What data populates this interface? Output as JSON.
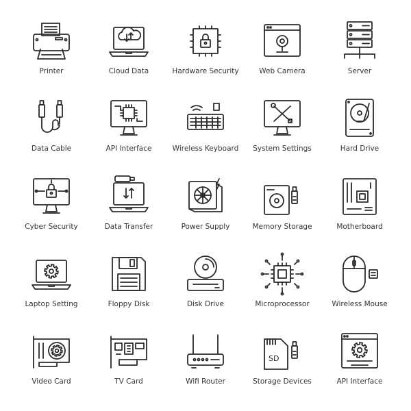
{
  "icon_color": "#2b2b2b",
  "background": "#ffffff",
  "sd_label": "SD",
  "icons": [
    {
      "label": "Printer",
      "icon": "printer-icon"
    },
    {
      "label": "Cloud Data",
      "icon": "cloud-data-icon"
    },
    {
      "label": "Hardware Security",
      "icon": "hardware-security-icon"
    },
    {
      "label": "Web Camera",
      "icon": "web-camera-icon"
    },
    {
      "label": "Server",
      "icon": "server-icon"
    },
    {
      "label": "Data Cable",
      "icon": "data-cable-icon"
    },
    {
      "label": "API Interface",
      "icon": "api-interface-icon"
    },
    {
      "label": "Wireless Keyboard",
      "icon": "wireless-keyboard-icon"
    },
    {
      "label": "System Settings",
      "icon": "system-settings-icon"
    },
    {
      "label": "Hard Drive",
      "icon": "hard-drive-icon"
    },
    {
      "label": "Cyber Security",
      "icon": "cyber-security-icon"
    },
    {
      "label": "Data Transfer",
      "icon": "data-transfer-icon"
    },
    {
      "label": "Power Supply",
      "icon": "power-supply-icon"
    },
    {
      "label": "Memory Storage",
      "icon": "memory-storage-icon"
    },
    {
      "label": "Motherboard",
      "icon": "motherboard-icon"
    },
    {
      "label": "Laptop Setting",
      "icon": "laptop-setting-icon"
    },
    {
      "label": "Floppy Disk",
      "icon": "floppy-disk-icon"
    },
    {
      "label": "Disk Drive",
      "icon": "disk-drive-icon"
    },
    {
      "label": "Microprocessor",
      "icon": "microprocessor-icon"
    },
    {
      "label": "Wireless Mouse",
      "icon": "wireless-mouse-icon"
    },
    {
      "label": "Video Card",
      "icon": "video-card-icon"
    },
    {
      "label": "TV Card",
      "icon": "tv-card-icon"
    },
    {
      "label": "Wifi Router",
      "icon": "wifi-router-icon"
    },
    {
      "label": "Storage Devices",
      "icon": "storage-devices-icon"
    },
    {
      "label": "API Interface",
      "icon": "api-interface-window-icon"
    }
  ]
}
